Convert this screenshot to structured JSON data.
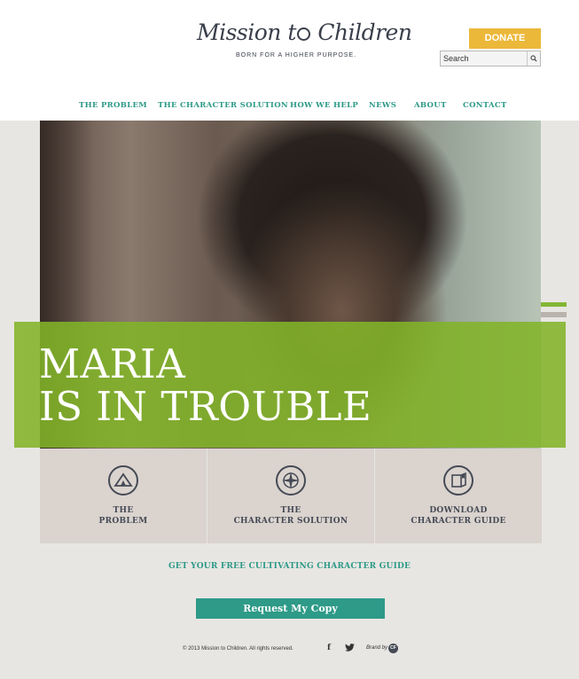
{
  "brand": {
    "name_part1": "Mission",
    "name_part2": "Children",
    "tagline": "BORN FOR A HIGHER PURPOSE."
  },
  "header": {
    "donate_label": "DONATE",
    "search_placeholder": "Search"
  },
  "nav": {
    "items": [
      {
        "label": "THE PROBLEM"
      },
      {
        "label": "THE CHARACTER SOLUTION"
      },
      {
        "label": "HOW WE HELP"
      },
      {
        "label": "NEWS"
      },
      {
        "label": "ABOUT"
      },
      {
        "label": "CONTACT"
      }
    ]
  },
  "hero": {
    "title_line1": "MARIA",
    "title_line2": "IS IN TROUBLE"
  },
  "cards": [
    {
      "line1": "THE",
      "line2": "PROBLEM",
      "icon": "mountain-icon"
    },
    {
      "line1": "THE",
      "line2": "CHARACTER SOLUTION",
      "icon": "compass-icon"
    },
    {
      "line1": "DOWNLOAD",
      "line2": "CHARACTER GUIDE",
      "icon": "guide-icon"
    }
  ],
  "cta": {
    "guide_text": "GET YOUR FREE CULTIVATING CHARACTER GUIDE",
    "request_label": "Request My Copy"
  },
  "footer": {
    "copyright": "© 2013 Mission to Children. All rights reserved.",
    "facebook": "f",
    "brand_by": "Brand by",
    "brand_logo": "CF"
  },
  "colors": {
    "accent_teal": "#2e9a88",
    "donate_yellow": "#ecb83a",
    "hero_green": "#84b634",
    "card_bg": "#dad3ce"
  }
}
